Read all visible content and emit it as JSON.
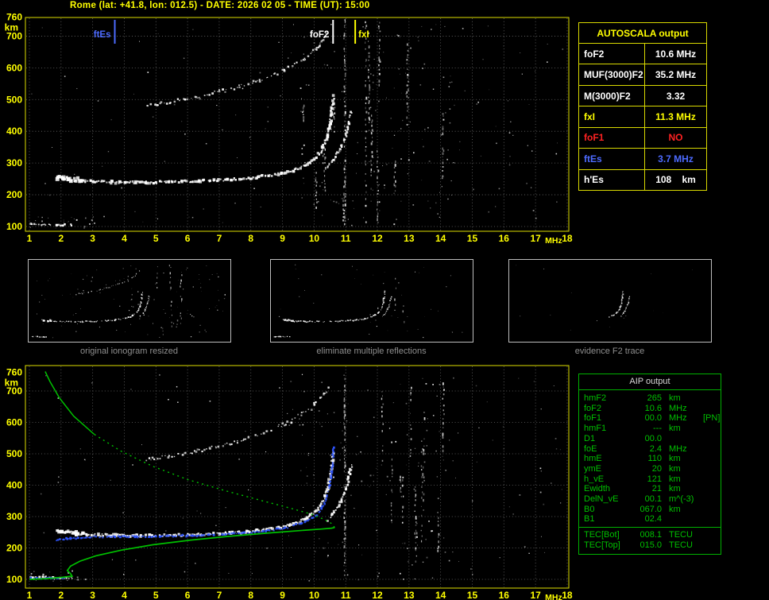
{
  "header": {
    "title": "Rome (lat: +41.8, lon: 012.5) - DATE: 2026 02 05 - TIME (UT): 15:00"
  },
  "colors": {
    "accent_yellow": "#ffff00",
    "accent_green": "#00c000",
    "accent_blue": "#4d6bff",
    "fit_blue": "#2f55ff",
    "accent_red": "#ff2222",
    "trace_white": "#ffffff",
    "grid_gray": "#6a6a6a",
    "caption_gray": "#8f8f8f"
  },
  "autoscala": {
    "title": "AUTOSCALA output",
    "rows": [
      {
        "label": "foF2",
        "value": "10.6 MHz",
        "color": "#ffffff"
      },
      {
        "label": "MUF(3000)F2",
        "value": "35.2 MHz",
        "color": "#ffffff"
      },
      {
        "label": "M(3000)F2",
        "value": "3.32",
        "color": "#ffffff"
      },
      {
        "label": "fxI",
        "value": "11.3 MHz",
        "color": "#ffff00"
      },
      {
        "label": "foF1",
        "value": "NO",
        "color": "#ff2222"
      },
      {
        "label": "ftEs",
        "value": "3.7 MHz",
        "color": "#4d6bff"
      },
      {
        "label": "h'Es",
        "value": "108",
        "unit": "km",
        "color": "#ffffff"
      }
    ]
  },
  "aip": {
    "title": "AIP output",
    "rows": [
      {
        "name": "hmF2",
        "value": "265",
        "unit": "km"
      },
      {
        "name": "foF2",
        "value": "10.6",
        "unit": "MHz"
      },
      {
        "name": "foF1",
        "value": "00.0",
        "unit": "MHz",
        "note": "[PN]"
      },
      {
        "name": "hmF1",
        "value": "---",
        "unit": "km"
      },
      {
        "name": "D1",
        "value": "00.0",
        "unit": ""
      },
      {
        "name": "foE",
        "value": "2.4",
        "unit": "MHz"
      },
      {
        "name": "hmE",
        "value": "110",
        "unit": "km"
      },
      {
        "name": "ymE",
        "value": "20",
        "unit": "km"
      },
      {
        "name": "h_vE",
        "value": "121",
        "unit": "km"
      },
      {
        "name": "Ewidth",
        "value": "21",
        "unit": "km"
      },
      {
        "name": "DelN_vE",
        "value": "00.1",
        "unit": "m^(-3)"
      },
      {
        "name": "B0",
        "value": "067.0",
        "unit": "km"
      },
      {
        "name": "B1",
        "value": "02.4",
        "unit": ""
      }
    ],
    "tec_rows": [
      {
        "name": "TEC[Bot]",
        "value": "008.1",
        "unit": "TECU"
      },
      {
        "name": "TEC[Top]",
        "value": "015.0",
        "unit": "TECU"
      }
    ]
  },
  "chart_data": {
    "type": "scatter",
    "title": "Ionogram with AUTOSCALA automatic scaling",
    "xlabel": "MHz",
    "ylabel": "km",
    "xlim": [
      1,
      18
    ],
    "ylim": [
      95,
      765
    ],
    "grid": true,
    "x_ticks": [
      1,
      2,
      3,
      4,
      5,
      6,
      7,
      8,
      9,
      10,
      11,
      12,
      13,
      14,
      15,
      16,
      17,
      18
    ],
    "y_ticks": [
      760,
      700,
      600,
      500,
      400,
      300,
      200,
      100
    ],
    "top_plot": {
      "markers": [
        {
          "label": "ftEs",
          "freq": 3.7,
          "color": "#4d6bff"
        },
        {
          "label": "foF2",
          "freq": 10.6,
          "color": "#ffffff"
        },
        {
          "label": "fxI",
          "freq": 11.3,
          "color": "#ffff00"
        }
      ]
    },
    "traces": {
      "f_trace_left_blob": [
        [
          1.85,
          254
        ],
        [
          2.7,
          246
        ]
      ],
      "f_layer_o_mode": [
        [
          1.9,
          257
        ],
        [
          2.1,
          250
        ],
        [
          2.5,
          245
        ],
        [
          3,
          242
        ],
        [
          3.6,
          240
        ],
        [
          4.4,
          239
        ],
        [
          5.4,
          240
        ],
        [
          6.4,
          243
        ],
        [
          7.4,
          248
        ],
        [
          8.2,
          255
        ],
        [
          8.9,
          265
        ],
        [
          9.4,
          278
        ],
        [
          9.8,
          297
        ],
        [
          10.1,
          320
        ],
        [
          10.28,
          348
        ],
        [
          10.4,
          378
        ],
        [
          10.48,
          412
        ],
        [
          10.54,
          450
        ],
        [
          10.58,
          482
        ],
        [
          10.61,
          510
        ]
      ],
      "f_layer_x_mode": [
        [
          10.42,
          288
        ],
        [
          10.65,
          315
        ],
        [
          10.85,
          348
        ],
        [
          11.0,
          385
        ],
        [
          11.1,
          425
        ],
        [
          11.18,
          462
        ]
      ],
      "second_hop_echo": [
        [
          4.7,
          480
        ],
        [
          5.4,
          492
        ],
        [
          6.2,
          507
        ],
        [
          7.1,
          527
        ],
        [
          7.9,
          549
        ],
        [
          8.6,
          573
        ],
        [
          9.2,
          600
        ],
        [
          9.7,
          630
        ],
        [
          10.05,
          660
        ],
        [
          10.3,
          690
        ],
        [
          10.45,
          712
        ]
      ],
      "es_layer": [
        [
          1.0,
          108
        ],
        [
          1.5,
          106
        ],
        [
          2.0,
          105
        ],
        [
          2.35,
          105
        ]
      ]
    },
    "bottom_plot": {
      "fitted_o_trace_blue": [
        [
          1.85,
          225
        ],
        [
          2.3,
          231
        ],
        [
          2.9,
          235
        ],
        [
          3.7,
          236
        ],
        [
          4.6,
          236
        ],
        [
          5.6,
          238
        ],
        [
          6.6,
          241
        ],
        [
          7.6,
          246
        ],
        [
          8.4,
          253
        ],
        [
          9.1,
          264
        ],
        [
          9.6,
          278
        ],
        [
          10.0,
          298
        ],
        [
          10.25,
          326
        ],
        [
          10.4,
          360
        ],
        [
          10.5,
          400
        ],
        [
          10.56,
          445
        ],
        [
          10.6,
          490
        ],
        [
          10.62,
          520
        ]
      ],
      "es_fitted_blue": [
        [
          1.0,
          104
        ],
        [
          1.5,
          103
        ],
        [
          2.1,
          103
        ]
      ],
      "profile_bottomside_green": [
        [
          1.0,
          100
        ],
        [
          1.5,
          102
        ],
        [
          2.0,
          106
        ],
        [
          2.35,
          110
        ],
        [
          2.3,
          118
        ],
        [
          2.2,
          128
        ],
        [
          2.3,
          142
        ],
        [
          2.6,
          158
        ],
        [
          3.1,
          175
        ],
        [
          3.9,
          193
        ],
        [
          4.9,
          210
        ],
        [
          6.1,
          225
        ],
        [
          7.3,
          237
        ],
        [
          8.5,
          247
        ],
        [
          9.5,
          255
        ],
        [
          10.2,
          260
        ],
        [
          10.55,
          263
        ],
        [
          10.65,
          265
        ]
      ],
      "profile_topside_green": [
        [
          10.65,
          265
        ],
        [
          10.55,
          278
        ],
        [
          10.3,
          292
        ],
        [
          9.9,
          308
        ],
        [
          9.2,
          328
        ],
        [
          8.3,
          352
        ],
        [
          7.2,
          382
        ],
        [
          6.0,
          418
        ],
        [
          4.9,
          460
        ],
        [
          3.9,
          508
        ],
        [
          3.05,
          562
        ],
        [
          2.4,
          620
        ],
        [
          1.95,
          678
        ],
        [
          1.65,
          730
        ],
        [
          1.5,
          762
        ]
      ]
    },
    "thumbnails": [
      {
        "caption": "original ionogram resized"
      },
      {
        "caption": "eliminate multiple reflections"
      },
      {
        "caption": "evidence F2 trace"
      }
    ]
  }
}
